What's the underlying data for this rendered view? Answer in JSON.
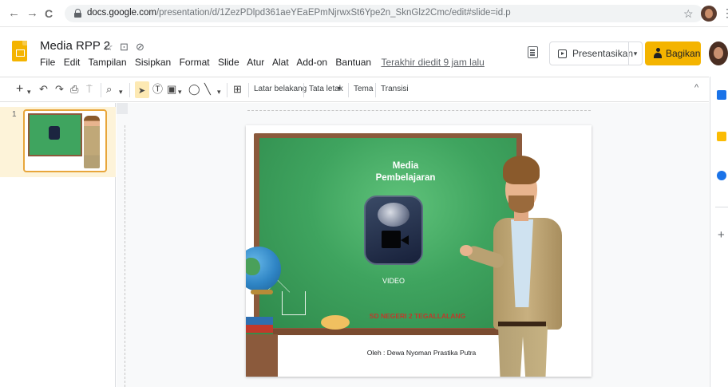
{
  "browser": {
    "back": "←",
    "forward": "→",
    "reload": "C",
    "url_host": "docs.google.com",
    "url_path": "/presentation/d/1ZezPDlpd361aeYEaEPmNjrwxSt6Ype2n_SknGlz2Cmc/edit#slide=id.p",
    "bookmark": "☆",
    "menu": "⋮"
  },
  "doc": {
    "title": "Media RPP 2",
    "star": "☆",
    "folder": "⊡",
    "cloud": "⊘",
    "last_edit": "Terakhir diedit 9 jam lalu"
  },
  "menu": [
    "File",
    "Edit",
    "Tampilan",
    "Sisipkan",
    "Format",
    "Slide",
    "Atur",
    "Alat",
    "Add-on",
    "Bantuan"
  ],
  "header_actions": {
    "present_label": "Presentasikan",
    "present_dropdown": "▾",
    "share_label": "Bagikan"
  },
  "toolbar": {
    "new_slide": "+",
    "new_slide_dd": "▾",
    "undo": "↶",
    "redo": "↷",
    "print": "⎙",
    "paint_format": "⍑",
    "zoom": "⌕",
    "zoom_dd": "▾",
    "select": "➤",
    "textbox": "Ⓣ",
    "image": "▣",
    "image_dd": "▾",
    "shape": "◯",
    "line": "╲",
    "line_dd": "▾",
    "comment": "⊞",
    "background": "Latar belakang",
    "layout": "Tata letak",
    "layout_dd": "▾",
    "theme": "Tema",
    "transition": "Transisi",
    "collapse": "^"
  },
  "filmstrip": {
    "slide_number": "1"
  },
  "slide": {
    "title_line1": "Media",
    "title_line2": "Pembelajaran",
    "video_label": "VIDEO",
    "school": "SD NEGERI 2 TEGALLALANG",
    "author": "Oleh : Dewa Nyoman Prastika Putra"
  },
  "side_panel": {
    "add": "+",
    "icons": [
      "calendar-icon",
      "keep-icon",
      "tasks-icon"
    ]
  },
  "colors": {
    "accent_yellow": "#f4b400",
    "board_green": "#3fa45f",
    "calendar_blue": "#1a73e8",
    "keep_yellow": "#fbbc04",
    "tasks_blue": "#1a73e8"
  }
}
